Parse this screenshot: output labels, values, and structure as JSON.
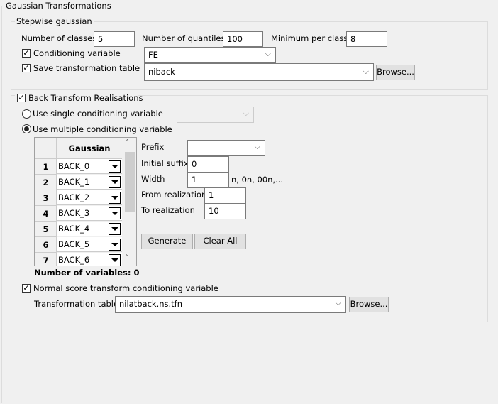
{
  "title": "Gaussian Transformations",
  "stepwise": {
    "title": "Stepwise gaussian",
    "classes_label": "Number of classes",
    "classes": "5",
    "quantiles_label": "Number of quantiles",
    "quantiles": "100",
    "min_label": "Minimum per class",
    "min": "8",
    "cond_label": "Conditioning variable",
    "cond_checked": true,
    "cond_value": "FE",
    "save_label": "Save transformation table",
    "save_checked": true,
    "save_value": "niback",
    "browse": "Browse..."
  },
  "back": {
    "title": "Back Transform Realisations",
    "checked": true,
    "single_label": "Use single conditioning variable",
    "single_value": "",
    "multiple_label": "Use multiple conditioning variable",
    "selected": "multiple",
    "table": {
      "header": "Gaussian",
      "rows": [
        {
          "n": "1",
          "v": "BACK_0"
        },
        {
          "n": "2",
          "v": "BACK_1"
        },
        {
          "n": "3",
          "v": "BACK_2"
        },
        {
          "n": "4",
          "v": "BACK_3"
        },
        {
          "n": "5",
          "v": "BACK_4"
        },
        {
          "n": "6",
          "v": "BACK_5"
        },
        {
          "n": "7",
          "v": "BACK_6"
        }
      ]
    },
    "prefix_label": "Prefix",
    "prefix": "",
    "suffix_label": "Initial suffix",
    "suffix": "0",
    "width_label": "Width",
    "width": "1",
    "width_hint": "n, 0n, 00n,...",
    "from_label": "From realization",
    "from": "1",
    "to_label": "To realization",
    "to": "10",
    "generate": "Generate",
    "clear": "Clear All",
    "count": "Number of variables: 0",
    "ns_label": "Normal score transform conditioning variable",
    "ns_checked": true,
    "tt_label": "Transformation table",
    "tt_value": "nilatback.ns.tfn",
    "browse": "Browse..."
  }
}
